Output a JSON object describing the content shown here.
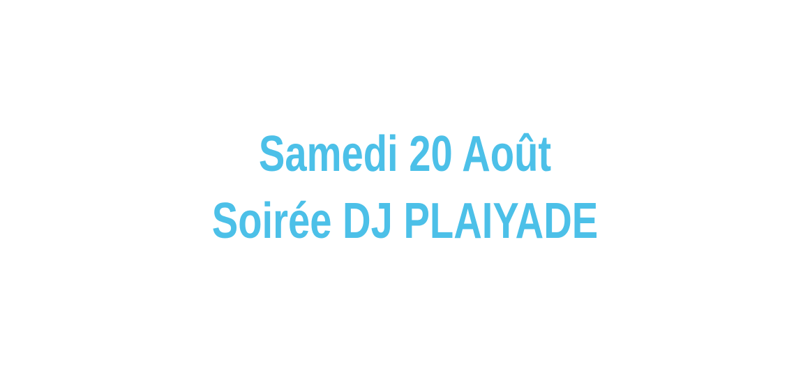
{
  "text_color": "#4cc0e8",
  "background_color": "#ffffff",
  "headline": {
    "line1": "Samedi 20 Août",
    "line2": "Soirée DJ PLAIYADE"
  }
}
